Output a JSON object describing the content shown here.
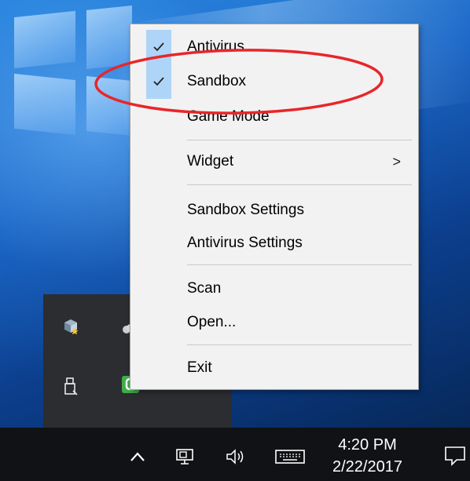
{
  "context_menu": {
    "items": [
      {
        "label": "Antivirus",
        "checked": true
      },
      {
        "label": "Sandbox",
        "checked": true
      },
      {
        "label": "Game Mode",
        "checked": false
      },
      {
        "label": "Widget",
        "submenu_arrow": ">"
      },
      {
        "label": "Sandbox Settings"
      },
      {
        "label": "Antivirus Settings"
      },
      {
        "label": "Scan"
      },
      {
        "label": "Open..."
      },
      {
        "label": "Exit"
      }
    ],
    "check_mark": "✓"
  },
  "taskbar": {
    "clock_time": "4:20 PM",
    "clock_date": "2/22/2017",
    "icons": [
      "chevron-up-icon",
      "network-icon",
      "volume-icon",
      "keyboard-icon",
      "action-center-icon"
    ]
  },
  "tray_flyout": {
    "icons": [
      "sandbox-tray-icon",
      "cloud-icon",
      "usb-drive-icon",
      "comodo-tray-icon"
    ]
  },
  "colors": {
    "menu_bg": "#f2f2f2",
    "check_highlight": "#aed5f7",
    "annotation": "#e8262a",
    "taskbar": "#101215"
  }
}
